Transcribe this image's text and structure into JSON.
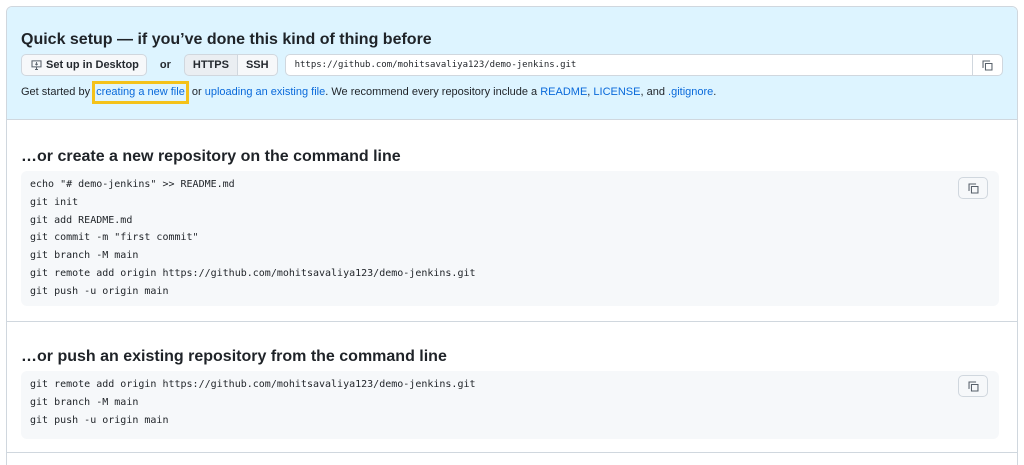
{
  "quick_setup": {
    "title": "Quick setup — if you’ve done this kind of thing before",
    "desktop_button": "Set up in Desktop",
    "or_label": "or",
    "https_label": "HTTPS",
    "ssh_label": "SSH",
    "clone_url": "https://github.com/mohitsavaliya123/demo-jenkins.git",
    "getstarted_prefix": "Get started by ",
    "creating_link": "creating a new file",
    "middle_text": " or ",
    "uploading_link": "uploading an existing file",
    "recommend_text": ". We recommend every repository include a ",
    "readme_link": "README",
    "comma": ", ",
    "license_link": "LICENSE",
    "and_text": ", and ",
    "gitignore_link": ".gitignore",
    "end_text": "."
  },
  "create_section": {
    "title": "…or create a new repository on the command line",
    "code": "echo \"# demo-jenkins\" >> README.md\ngit init\ngit add README.md\ngit commit -m \"first commit\"\ngit branch -M main\ngit remote add origin https://github.com/mohitsavaliya123/demo-jenkins.git\ngit push -u origin main"
  },
  "push_section": {
    "title": "…or push an existing repository from the command line",
    "code": "git remote add origin https://github.com/mohitsavaliya123/demo-jenkins.git\ngit branch -M main\ngit push -u origin main"
  },
  "icons": {
    "copy": "copy-icon",
    "desktop": "desktop-icon"
  },
  "colors": {
    "quick_bg": "#ddf4ff",
    "link": "#0969da",
    "highlight": "#f4c21a",
    "code_bg": "#f6f8fa"
  }
}
